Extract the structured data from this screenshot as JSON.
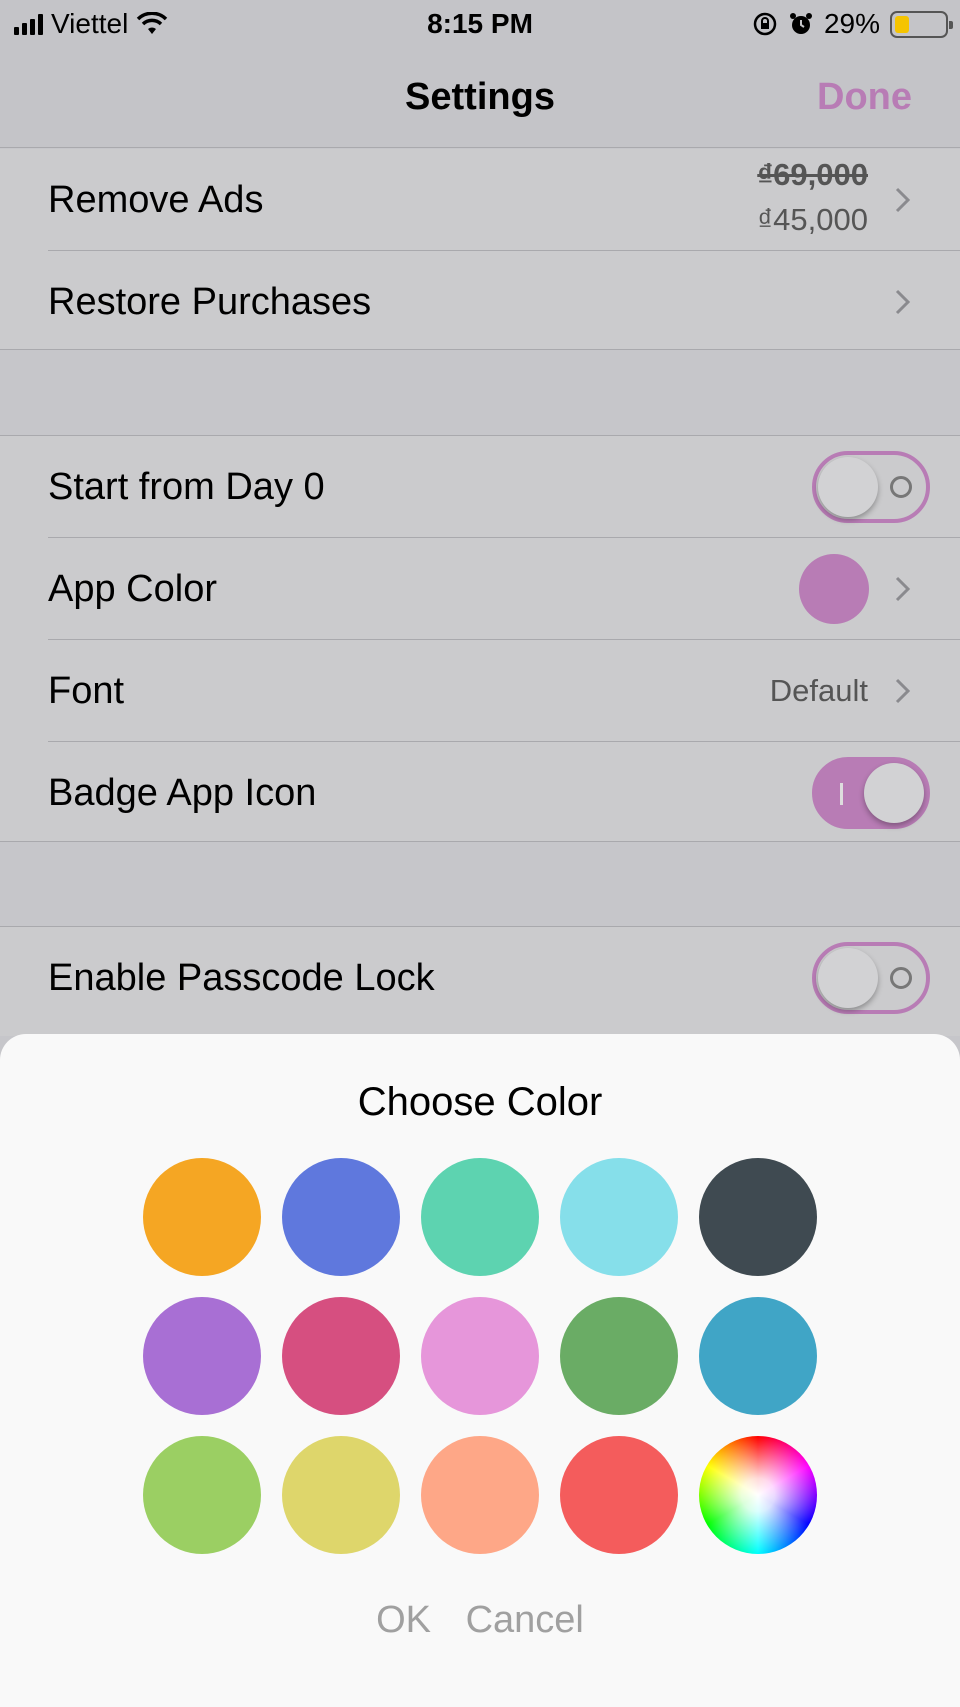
{
  "status_bar": {
    "carrier": "Viettel",
    "time": "8:15 PM",
    "battery": "29%",
    "battery_level": 0.29,
    "icons": [
      "signal-icon",
      "wifi-icon",
      "orientation-lock-icon",
      "alarm-icon",
      "battery-icon"
    ]
  },
  "nav": {
    "title": "Settings",
    "done_label": "Done"
  },
  "purchases": {
    "remove_ads": {
      "label": "Remove Ads",
      "price_old": "₫69,000",
      "price_new": "₫45,000"
    },
    "restore": {
      "label": "Restore Purchases"
    }
  },
  "settings": {
    "start_day0": {
      "label": "Start from Day 0",
      "enabled": false
    },
    "app_color": {
      "label": "App Color",
      "color": "#b87cb5"
    },
    "font": {
      "label": "Font",
      "value": "Default"
    },
    "badge": {
      "label": "Badge App Icon",
      "enabled": true
    }
  },
  "security": {
    "passcode": {
      "label": "Enable Passcode Lock",
      "enabled": false
    }
  },
  "color_sheet": {
    "title": "Choose Color",
    "swatches": [
      "#f5a623",
      "#5f78dd",
      "#5dd3b0",
      "#86dfea",
      "#3f4a51",
      "#a86fd4",
      "#d64f80",
      "#e696da",
      "#6aac65",
      "#40a5c6",
      "#9bcf63",
      "#ded66b",
      "#fea787",
      "#f45c5c",
      "color-wheel"
    ],
    "ok_label": "OK",
    "cancel_label": "Cancel"
  },
  "colors": {
    "accent": "#b87cb5",
    "background": "#c6c6ca",
    "sheet": "#f9f9f9"
  }
}
